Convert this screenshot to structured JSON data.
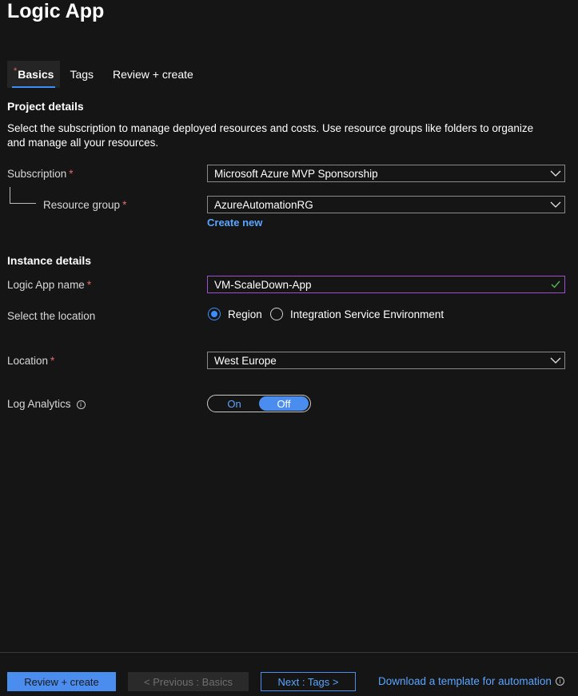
{
  "app_title": "Logic App",
  "tabs": [
    {
      "label": "Basics",
      "required_marker": "*"
    },
    {
      "label": "Tags"
    },
    {
      "label": "Review + create"
    }
  ],
  "project_details": {
    "heading": "Project details",
    "description": "Select the subscription to manage deployed resources and costs. Use resource groups like folders to organize and manage all your resources.",
    "subscription": {
      "label": "Subscription",
      "required": "*",
      "value": "Microsoft Azure MVP Sponsorship"
    },
    "resource_group": {
      "label": "Resource group",
      "required": "*",
      "value": "AzureAutomationRG",
      "create_new": "Create new"
    }
  },
  "instance_details": {
    "heading": "Instance details",
    "name": {
      "label": "Logic App name",
      "required": "*",
      "value": "VM-ScaleDown-App"
    },
    "select_location": {
      "label": "Select the location",
      "options": [
        "Region",
        "Integration Service Environment"
      ],
      "selected": "Region"
    },
    "location": {
      "label": "Location",
      "required": "*",
      "value": "West Europe"
    },
    "log_analytics": {
      "label": "Log Analytics",
      "info": "i",
      "on_label": "On",
      "off_label": "Off",
      "selected": "Off"
    }
  },
  "footer": {
    "review_create": "Review + create",
    "previous": "< Previous : Basics",
    "next": "Next : Tags >",
    "download": "Download a template for automation",
    "download_info": "i"
  },
  "colors": {
    "accent": "#4b8dee",
    "link": "#5aa5ff",
    "required": "#e36b6b",
    "valid": "#5bb55b",
    "focus_border": "#9b4fd1"
  },
  "icons": [
    "chevron-down-icon",
    "checkmark-icon",
    "info-icon",
    "radio-selected-icon",
    "radio-empty-icon"
  ]
}
